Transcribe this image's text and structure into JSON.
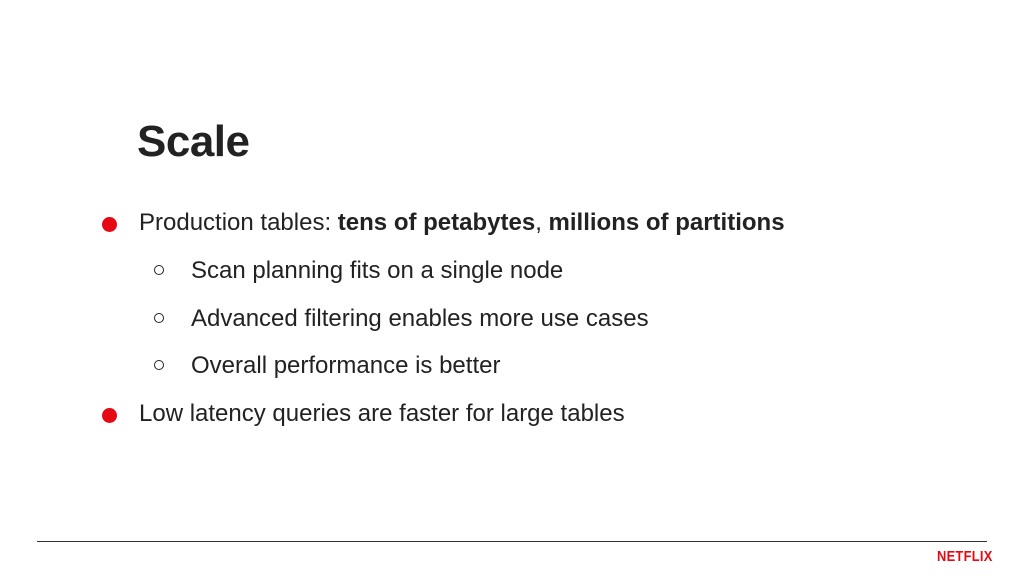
{
  "slide": {
    "title": "Scale",
    "bullets": [
      {
        "level": 1,
        "prefix": "Production tables: ",
        "bold1": "tens of petabytes",
        "sep": ", ",
        "bold2": "millions of partitions"
      },
      {
        "level": 2,
        "text": "Scan planning fits on a single node"
      },
      {
        "level": 2,
        "text": "Advanced filtering enables more use cases"
      },
      {
        "level": 2,
        "text": "Overall performance is better"
      },
      {
        "level": 1,
        "text": "Low latency queries are faster for large tables"
      }
    ],
    "logo_text": "NETFLIX"
  },
  "colors": {
    "accent": "#e50914",
    "text": "#222222",
    "rule": "#333333",
    "background": "#ffffff"
  },
  "icons": {
    "level1_bullet": "filled-red-circle",
    "level2_bullet": "hollow-circle"
  }
}
